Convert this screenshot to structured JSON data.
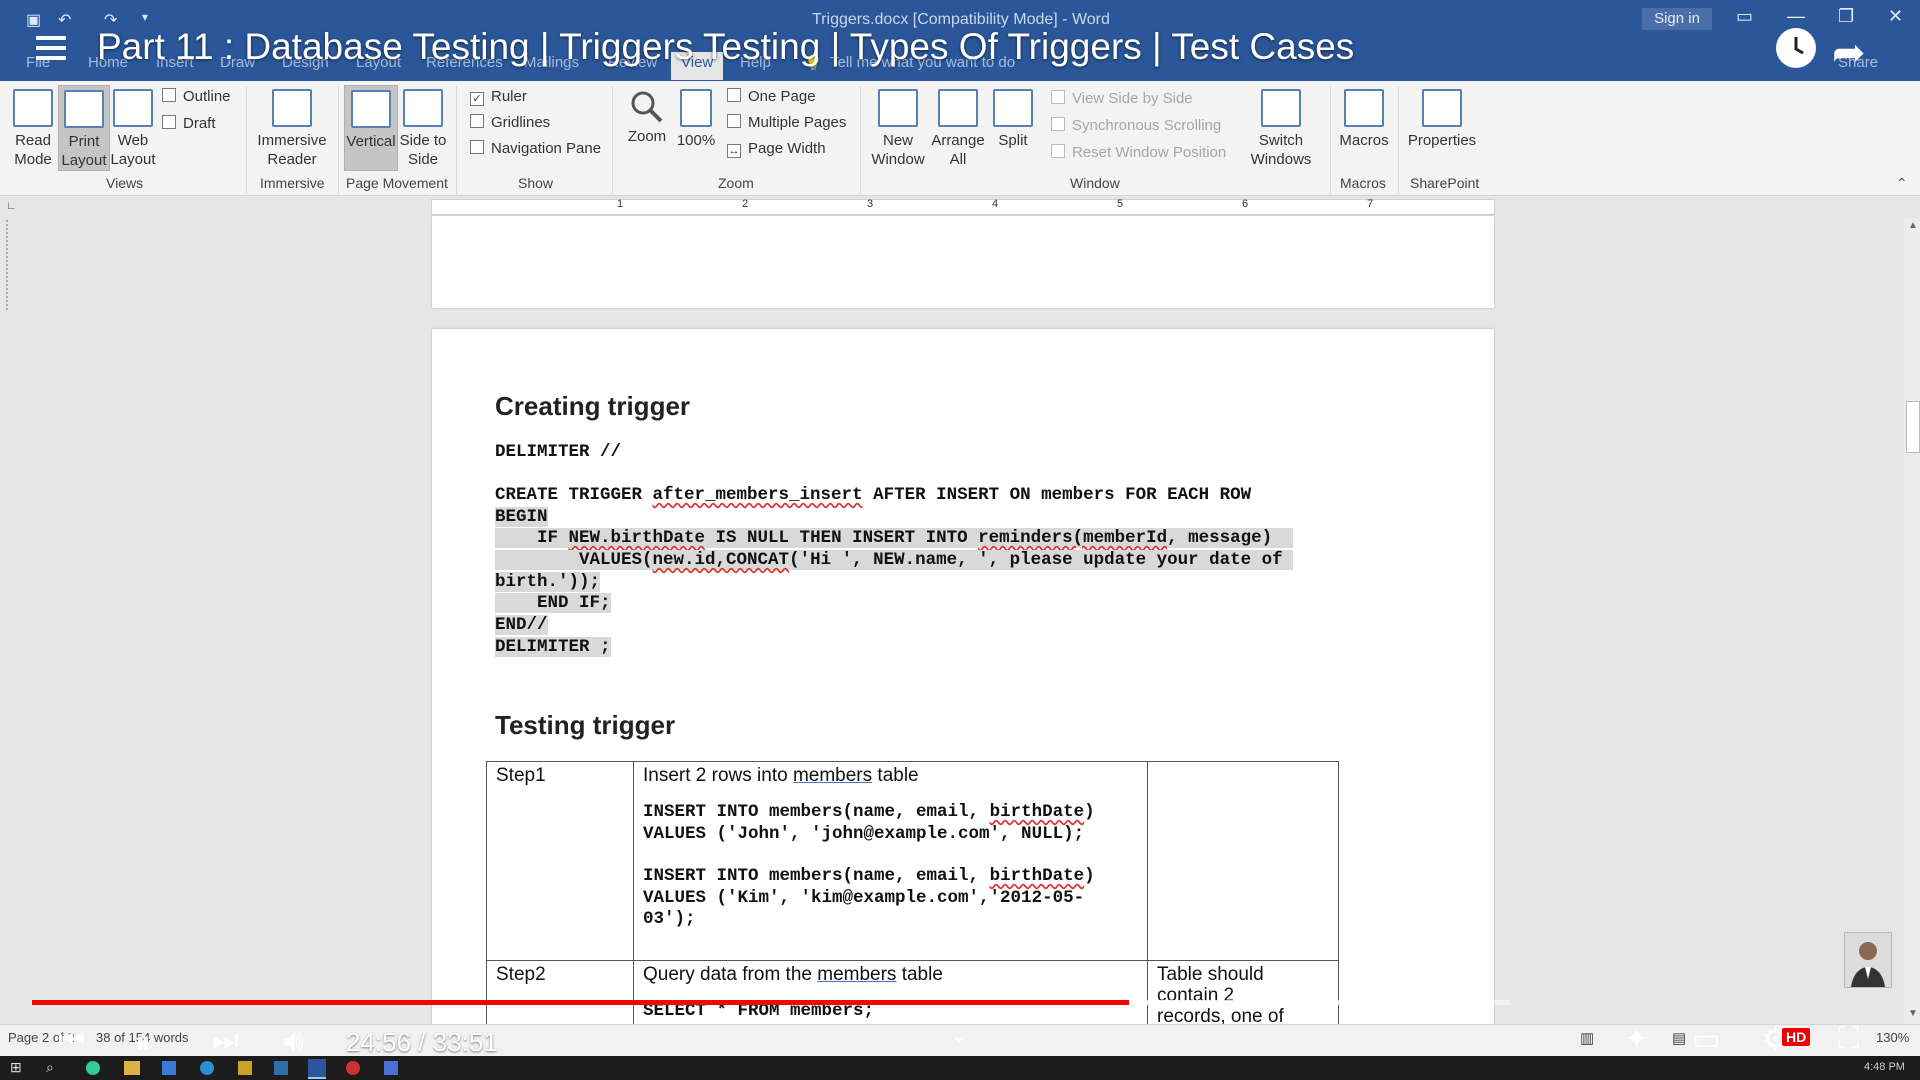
{
  "word": {
    "title": "Triggers.docx [Compatibility Mode]  -  Word",
    "sign_in": "Sign in",
    "tabs": [
      "File",
      "Home",
      "Insert",
      "Draw",
      "Design",
      "Layout",
      "References",
      "Mailings",
      "Review",
      "View",
      "Help"
    ],
    "active_tab": "View",
    "tell_me": "Tell me what you want to do",
    "share": "Share"
  },
  "video": {
    "title": "Part 11 : Database Testing | Triggers Testing | Types Of Triggers | Test Cases",
    "time": "24:56 / 33:51",
    "progress": 0.742,
    "buffered": 0.934,
    "hd": "HD"
  },
  "ribbon": {
    "views": {
      "read_mode": "Read Mode",
      "print_layout": "Print Layout",
      "web_layout": "Web Layout",
      "outline": "Outline",
      "draft": "Draft",
      "group": "Views"
    },
    "immersive": {
      "reader": "Immersive Reader",
      "group": "Immersive"
    },
    "page_movement": {
      "vertical": "Vertical",
      "side_to_side": "Side to Side",
      "group": "Page Movement"
    },
    "show": {
      "ruler": "Ruler",
      "gridlines": "Gridlines",
      "navigation_pane": "Navigation Pane",
      "group": "Show",
      "ruler_checked": true
    },
    "zoom": {
      "zoom": "Zoom",
      "hundred": "100%",
      "one_page": "One Page",
      "multiple_pages": "Multiple Pages",
      "page_width": "Page Width",
      "group": "Zoom"
    },
    "window": {
      "new_window": "New Window",
      "arrange_all": "Arrange All",
      "split": "Split",
      "view_side_by_side": "View Side by Side",
      "sync_scrolling": "Synchronous Scrolling",
      "reset_window": "Reset Window Position",
      "switch_windows": "Switch Windows",
      "group": "Window"
    },
    "macros": {
      "macros": "Macros",
      "group": "Macros"
    },
    "sharepoint": {
      "properties": "Properties",
      "group": "SharePoint"
    }
  },
  "ruler_numbers": [
    "1",
    "2",
    "3",
    "4",
    "5",
    "6",
    "7"
  ],
  "document": {
    "heading_create": "Creating trigger",
    "delimiter_line": "DELIMITER //",
    "create_prefix": "CREATE TRIGGER ",
    "create_name": "after_members_insert",
    "create_suffix": " AFTER INSERT ON members FOR EACH ROW",
    "begin": "BEGIN",
    "if_prefix": "    IF ",
    "if_field": "NEW.birthDate",
    "if_mid": " IS NULL THEN INSERT INTO ",
    "if_table": "reminders(memberId",
    "if_suffix": ", message)",
    "values_prefix": "        VALUES(",
    "values_func": "new.id,CONCAT",
    "values_suffix": "('Hi ', NEW.name, ', please update your date of",
    "birth_line": "birth.'));",
    "end_if": "    END IF;",
    "end_line": "END//",
    "delimiter_end": "DELIMITER ;",
    "heading_test": "Testing trigger",
    "table": {
      "step1": "Step1",
      "step1_desc_pre": "Insert 2 rows into ",
      "step1_desc_link": "members",
      "step1_desc_post": " table",
      "insert1_pre": "INSERT INTO members(name, email, ",
      "insert1_field": "birthDate",
      "insert1_post": ")",
      "values1": "VALUES ('John', 'john@example.com', NULL);",
      "insert2_pre": "INSERT INTO members(name, email, ",
      "insert2_field": "birthDate",
      "insert2_post": ")",
      "values2a": "VALUES ('Kim', 'kim@example.com','2012-05-",
      "values2b": "03');",
      "step2": "Step2",
      "step2_desc_pre": "Query data from the ",
      "step2_desc_link": "members",
      "step2_desc_post": " table",
      "step2_query": "SELECT * FROM members;",
      "step2_expected_a": "Table should",
      "step2_expected_b": "contain 2",
      "step2_expected_c": "records, one of"
    }
  },
  "status": {
    "page": "Page 2 of 2",
    "words": "38 of 154 words",
    "zoom": "130%",
    "clock": "4:48 PM"
  }
}
